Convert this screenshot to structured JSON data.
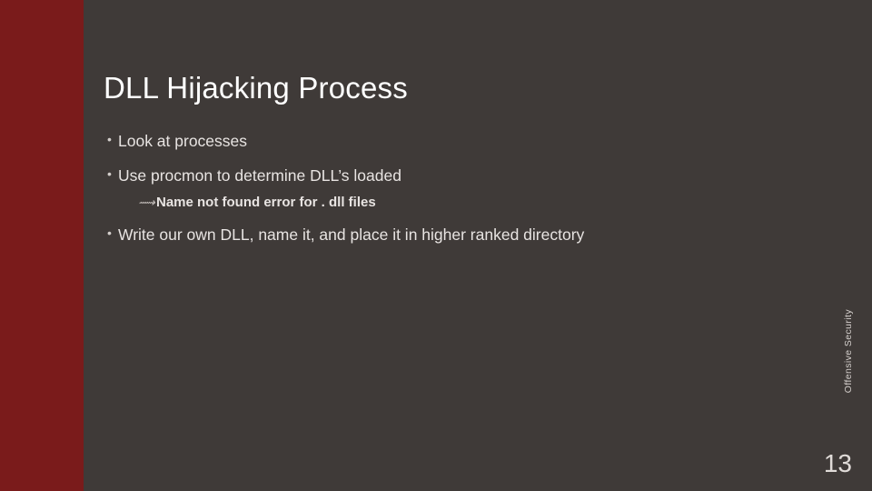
{
  "title": "DLL Hijacking Process",
  "bullets": {
    "b1": "Look at processes",
    "b2": "Use procmon to determine DLL’s loaded",
    "b2_sub": "Name not found error for . dll files",
    "b3": "Write our own DLL, name it, and place it in higher ranked directory"
  },
  "side_label": "Offensive Security",
  "page_number": "13"
}
